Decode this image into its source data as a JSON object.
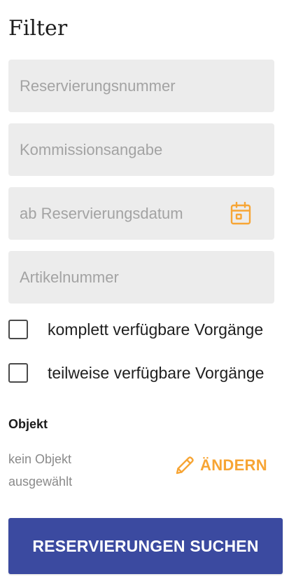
{
  "filter": {
    "title": "Filter",
    "fields": {
      "reservation_number": {
        "placeholder": "Reservierungsnummer",
        "value": ""
      },
      "commission": {
        "placeholder": "Kommissionsangabe",
        "value": ""
      },
      "from_date": {
        "placeholder": "ab Reservierungsdatum",
        "value": "",
        "icon": "calendar-icon"
      },
      "article_number": {
        "placeholder": "Artikelnummer",
        "value": ""
      }
    },
    "checkboxes": [
      {
        "label": "komplett verfügbare Vorgänge",
        "checked": false
      },
      {
        "label": "teilweise verfügbare Vorgänge",
        "checked": false
      }
    ],
    "object": {
      "heading": "Objekt",
      "value": "kein Objekt ausgewählt",
      "change_label": "ÄNDERN",
      "change_icon": "pencil-icon"
    },
    "search_button_label": "RESERVIERUNGEN SUCHEN"
  },
  "colors": {
    "accent": "#f7a535",
    "primary_button": "#3b4aa0",
    "field_background": "#ececec",
    "placeholder": "#a3a3a3"
  }
}
